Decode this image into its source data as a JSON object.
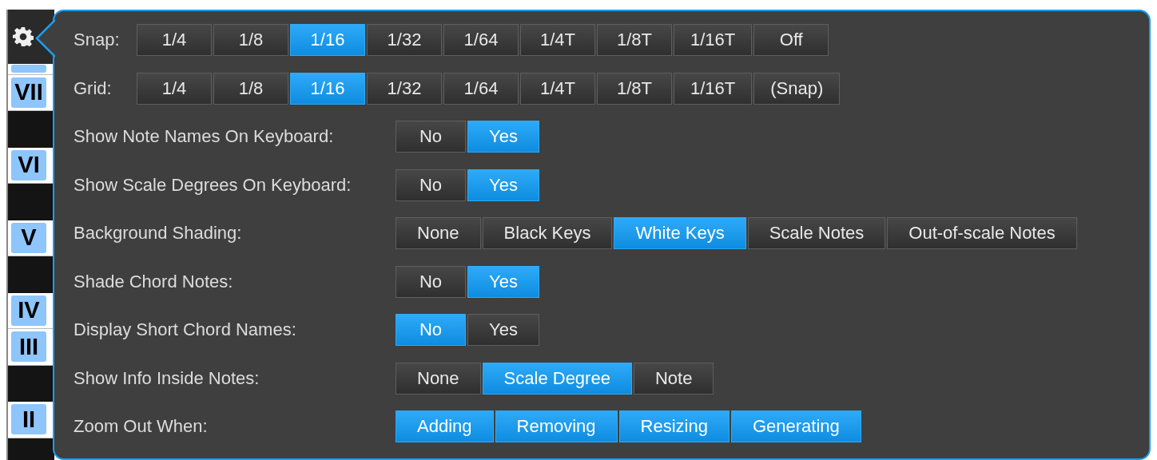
{
  "keyboard": [
    {
      "kind": "white"
    },
    {
      "kind": "white",
      "degree": "VII"
    },
    {
      "kind": "black"
    },
    {
      "kind": "white",
      "degree": "VI"
    },
    {
      "kind": "black"
    },
    {
      "kind": "white",
      "degree": "V"
    },
    {
      "kind": "black"
    },
    {
      "kind": "white",
      "degree": "IV"
    },
    {
      "kind": "white",
      "degree": "III"
    },
    {
      "kind": "black"
    },
    {
      "kind": "white",
      "degree": "II"
    },
    {
      "kind": "black"
    }
  ],
  "grid_settings": [
    {
      "label": "Snap:",
      "options": [
        {
          "label": "1/4",
          "selected": false
        },
        {
          "label": "1/8",
          "selected": false
        },
        {
          "label": "1/16",
          "selected": true
        },
        {
          "label": "1/32",
          "selected": false
        },
        {
          "label": "1/64",
          "selected": false
        },
        {
          "label": "1/4T",
          "selected": false
        },
        {
          "label": "1/8T",
          "selected": false
        },
        {
          "label": "1/16T",
          "selected": false
        },
        {
          "label": "Off",
          "selected": false
        }
      ]
    },
    {
      "label": "Grid:",
      "options": [
        {
          "label": "1/4",
          "selected": false
        },
        {
          "label": "1/8",
          "selected": false
        },
        {
          "label": "1/16",
          "selected": true
        },
        {
          "label": "1/32",
          "selected": false
        },
        {
          "label": "1/64",
          "selected": false
        },
        {
          "label": "1/4T",
          "selected": false
        },
        {
          "label": "1/8T",
          "selected": false
        },
        {
          "label": "1/16T",
          "selected": false
        },
        {
          "label": "(Snap)",
          "selected": false
        }
      ]
    }
  ],
  "settings": [
    {
      "label": "Show Note Names On Keyboard:",
      "options": [
        {
          "label": "No",
          "selected": false
        },
        {
          "label": "Yes",
          "selected": true
        }
      ]
    },
    {
      "label": "Show Scale Degrees On Keyboard:",
      "options": [
        {
          "label": "No",
          "selected": false
        },
        {
          "label": "Yes",
          "selected": true
        }
      ]
    },
    {
      "label": "Background Shading:",
      "options": [
        {
          "label": "None",
          "selected": false
        },
        {
          "label": "Black Keys",
          "selected": false
        },
        {
          "label": "White Keys",
          "selected": true
        },
        {
          "label": "Scale Notes",
          "selected": false
        },
        {
          "label": "Out-of-scale Notes",
          "selected": false
        }
      ]
    },
    {
      "label": "Shade Chord Notes:",
      "options": [
        {
          "label": "No",
          "selected": false
        },
        {
          "label": "Yes",
          "selected": true
        }
      ]
    },
    {
      "label": "Display Short Chord Names:",
      "options": [
        {
          "label": "No",
          "selected": true
        },
        {
          "label": "Yes",
          "selected": false
        }
      ]
    },
    {
      "label": "Show Info Inside Notes:",
      "options": [
        {
          "label": "None",
          "selected": false
        },
        {
          "label": "Scale Degree",
          "selected": true
        },
        {
          "label": "Note",
          "selected": false
        }
      ]
    },
    {
      "label": "Zoom Out When:",
      "options": [
        {
          "label": "Adding",
          "selected": true
        },
        {
          "label": "Removing",
          "selected": true
        },
        {
          "label": "Resizing",
          "selected": true
        },
        {
          "label": "Generating",
          "selected": true
        }
      ]
    }
  ]
}
